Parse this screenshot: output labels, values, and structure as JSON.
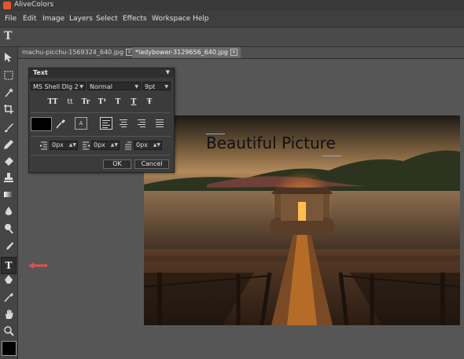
{
  "app": {
    "title": "AliveColors"
  },
  "menu": [
    "File",
    "Edit",
    "Image",
    "Layers",
    "Select",
    "Effects",
    "Workspace",
    "Help"
  ],
  "options_bar": {
    "tool_glyph": "T"
  },
  "tabs": [
    {
      "label": "machu-picchu-1569324_640.jpg",
      "close": "⊠",
      "active": false
    },
    {
      "label": "*ladybower-3129656_640.jpg",
      "close": "⊠",
      "active": true
    }
  ],
  "text_panel": {
    "title": "Text",
    "font_family": "MS Shell Dlg 2",
    "font_style": "Normal",
    "font_size": "9pt",
    "style_buttons": [
      "TT",
      "tt",
      "Tr",
      "T¹",
      "T",
      "T",
      "Ŧ"
    ],
    "indents": [
      "0px",
      "0px",
      "0px"
    ],
    "ok_label": "OK",
    "cancel_label": "Cancel"
  },
  "canvas": {
    "text_layer": "Beautiful Picture"
  },
  "colors": {
    "foreground": "#000000",
    "accent_arrow": "#e05050"
  }
}
